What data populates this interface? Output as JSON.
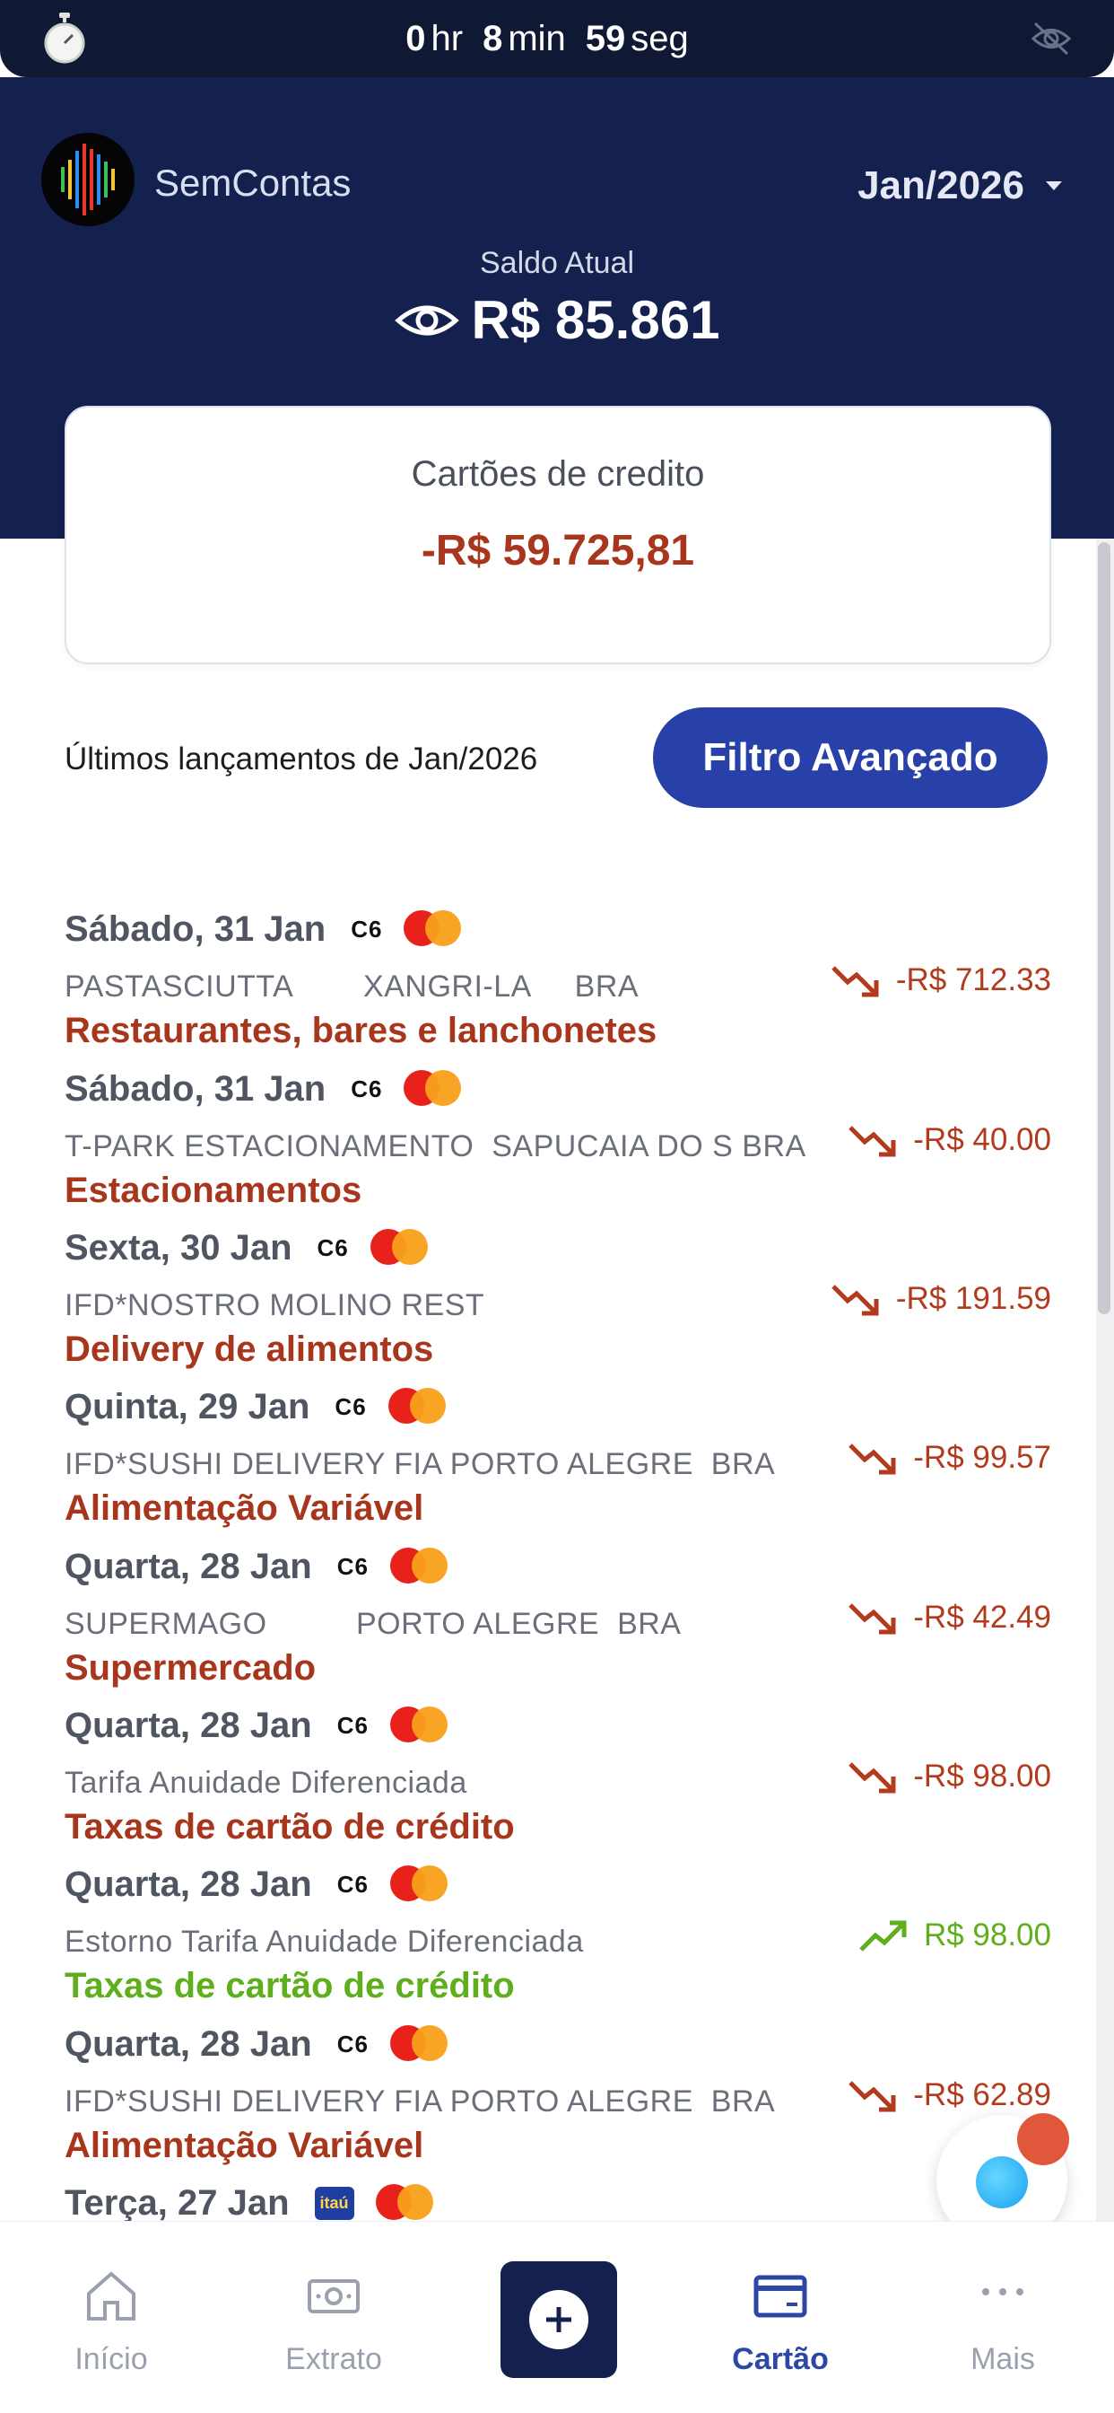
{
  "timer": {
    "hours": "0",
    "hours_unit": "hr",
    "minutes": "8",
    "minutes_unit": "min",
    "seconds": "59",
    "seconds_unit": "seg"
  },
  "header": {
    "app_name": "SemContas",
    "month": "Jan/2026",
    "balance_label": "Saldo Atual",
    "balance_value": "R$ 85.861"
  },
  "credit_cards": {
    "title": "Cartões de credito",
    "value": "-R$ 59.725,81"
  },
  "section": {
    "title": "Últimos lançamentos de Jan/2026",
    "filter_label": "Filtro Avançado"
  },
  "transactions": [
    {
      "date": "Sábado, 31 Jan",
      "bank": "C6",
      "desc": "PASTASCIUTTA        XANGRI-LA     BRA",
      "category": "Restaurantes, bares e lanchonetes",
      "amount": "-R$ 712.33",
      "direction": "out"
    },
    {
      "date": "Sábado, 31 Jan",
      "bank": "C6",
      "desc": "T-PARK ESTACIONAMENTO  SAPUCAIA DO S BRA",
      "category": "Estacionamentos",
      "amount": "-R$ 40.00",
      "direction": "out"
    },
    {
      "date": "Sexta, 30 Jan",
      "bank": "C6",
      "desc": "IFD*NOSTRO MOLINO REST",
      "category": "Delivery de alimentos",
      "amount": "-R$ 191.59",
      "direction": "out"
    },
    {
      "date": "Quinta, 29 Jan",
      "bank": "C6",
      "desc": "IFD*SUSHI DELIVERY FIA PORTO ALEGRE  BRA",
      "category": "Alimentação Variável",
      "amount": "-R$ 99.57",
      "direction": "out"
    },
    {
      "date": "Quarta, 28 Jan",
      "bank": "C6",
      "desc": "SUPERMAGO          PORTO ALEGRE  BRA",
      "category": "Supermercado",
      "amount": "-R$ 42.49",
      "direction": "out"
    },
    {
      "date": "Quarta, 28 Jan",
      "bank": "C6",
      "desc": "Tarifa Anuidade Diferenciada",
      "category": "Taxas de cartão de crédito",
      "amount": "-R$ 98.00",
      "direction": "out"
    },
    {
      "date": "Quarta, 28 Jan",
      "bank": "C6",
      "desc": "Estorno Tarifa Anuidade Diferenciada",
      "category": "Taxas de cartão de crédito",
      "amount": "R$ 98.00",
      "direction": "in"
    },
    {
      "date": "Quarta, 28 Jan",
      "bank": "C6",
      "desc": "IFD*SUSHI DELIVERY FIA PORTO ALEGRE  BRA",
      "category": "Alimentação Variável",
      "amount": "-R$ 62.89",
      "direction": "out"
    },
    {
      "date": "Terça, 27 Jan",
      "bank": "itaú",
      "desc": "",
      "category": "",
      "amount": "",
      "direction": "out"
    }
  ],
  "nav": {
    "home": "Início",
    "statement": "Extrato",
    "card": "Cartão",
    "more": "Mais"
  },
  "colors": {
    "header_bg": "#14214f",
    "accent": "#2841a8",
    "negative": "#a8361d",
    "positive": "#5fae1d"
  },
  "icons": [
    "stopwatch-icon",
    "eye-off-icon",
    "eye-icon",
    "chevron-down-icon",
    "trend-down-icon",
    "trend-up-icon",
    "mastercard-icon",
    "home-icon",
    "money-icon",
    "plus-icon",
    "credit-card-icon",
    "more-icon",
    "chat-icon"
  ]
}
